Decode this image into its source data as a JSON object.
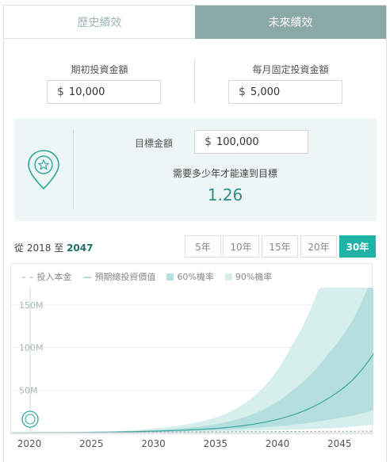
{
  "tabs": {
    "history": "歷史績效",
    "future": "未來績效"
  },
  "inputs": {
    "initial": {
      "label": "期初投資金額",
      "currency": "$",
      "value": "10,000"
    },
    "monthly": {
      "label": "每月固定投資金額",
      "currency": "$",
      "value": "5,000"
    }
  },
  "goal": {
    "label": "目標金額",
    "currency": "$",
    "value": "100,000",
    "question": "需要多少年才能達到目標",
    "answer": "1.26",
    "icon": "target-pin-star-icon"
  },
  "range": {
    "prefix": "從",
    "start": "2018",
    "mid": "至",
    "end": "2047"
  },
  "year_buttons": [
    "5年",
    "10年",
    "15年",
    "20年",
    "30年"
  ],
  "active_year_button": "30年",
  "legend": {
    "principal": "投入本金",
    "expected": "預期總投資價值",
    "p60": "60%機率",
    "p90": "90%機率"
  },
  "colors": {
    "accent": "#1fb3a6",
    "tab_active": "#8aa8a5",
    "band60": "#b5dede",
    "band90": "#d6eeec",
    "line": "#3aa69d"
  },
  "chart_data": {
    "type": "area",
    "x_ticks": [
      "2020",
      "2025",
      "2030",
      "2035",
      "2040",
      "2045"
    ],
    "y_ticks": [
      "50M",
      "100M",
      "150M"
    ],
    "ylim": [
      0,
      200
    ],
    "xlim": [
      2018,
      2048
    ],
    "x": [
      2018,
      2025,
      2030,
      2035,
      2038,
      2041,
      2044,
      2046,
      2048
    ],
    "series": [
      {
        "name": "預期總投資價值",
        "values": [
          0.01,
          0.5,
          1.8,
          5,
          10,
          20,
          40,
          62,
          100
        ]
      },
      {
        "name": "60%機率",
        "upper": [
          0.01,
          0.7,
          3,
          10,
          22,
          48,
          92,
          132,
          200
        ],
        "lower": [
          0.01,
          0.3,
          1,
          3,
          5.5,
          9,
          15,
          20,
          28
        ]
      },
      {
        "name": "90%機率",
        "upper": [
          0.01,
          0.9,
          5,
          18,
          42,
          100,
          200,
          200,
          200
        ],
        "lower": [
          0.01,
          0.2,
          0.6,
          1.5,
          2.5,
          3.5,
          5,
          7,
          10
        ]
      },
      {
        "name": "投入本金",
        "values": [
          0.01,
          0.4,
          0.7,
          1.0,
          1.2,
          1.4,
          1.6,
          1.7,
          1.8
        ]
      }
    ]
  }
}
